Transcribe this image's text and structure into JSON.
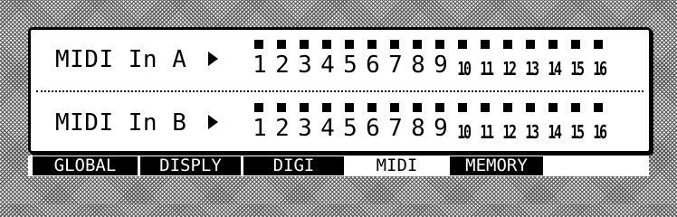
{
  "display": {
    "ports": [
      {
        "label": "MIDI In A",
        "channels": [
          "1",
          "2",
          "3",
          "4",
          "5",
          "6",
          "7",
          "8",
          "9",
          "10",
          "11",
          "12",
          "13",
          "14",
          "15",
          "16"
        ],
        "active_channels": [
          1,
          2,
          3,
          4,
          5,
          6,
          7,
          8,
          9,
          10,
          11,
          12,
          13,
          14,
          15,
          16
        ]
      },
      {
        "label": "MIDI In B",
        "channels": [
          "1",
          "2",
          "3",
          "4",
          "5",
          "6",
          "7",
          "8",
          "9",
          "10",
          "11",
          "12",
          "13",
          "14",
          "15",
          "16"
        ],
        "active_channels": [
          1,
          2,
          3,
          4,
          5,
          6,
          7,
          8,
          9,
          10,
          11,
          12,
          13,
          14,
          15,
          16
        ]
      }
    ]
  },
  "tabs": [
    {
      "label": "GLOBAL",
      "selected": false
    },
    {
      "label": "DISPLY",
      "selected": false
    },
    {
      "label": " DIGI ",
      "selected": false
    },
    {
      "label": " MIDI ",
      "selected": true
    },
    {
      "label": "MEMORY",
      "selected": false
    }
  ],
  "colors": {
    "lcd_background": "#ffffff",
    "lcd_ink": "#000000",
    "bezel_pattern": "#5a5a5a"
  },
  "icons": {
    "port_indicator": "triangle-right-icon",
    "channel_marker": "square-marker-icon"
  }
}
